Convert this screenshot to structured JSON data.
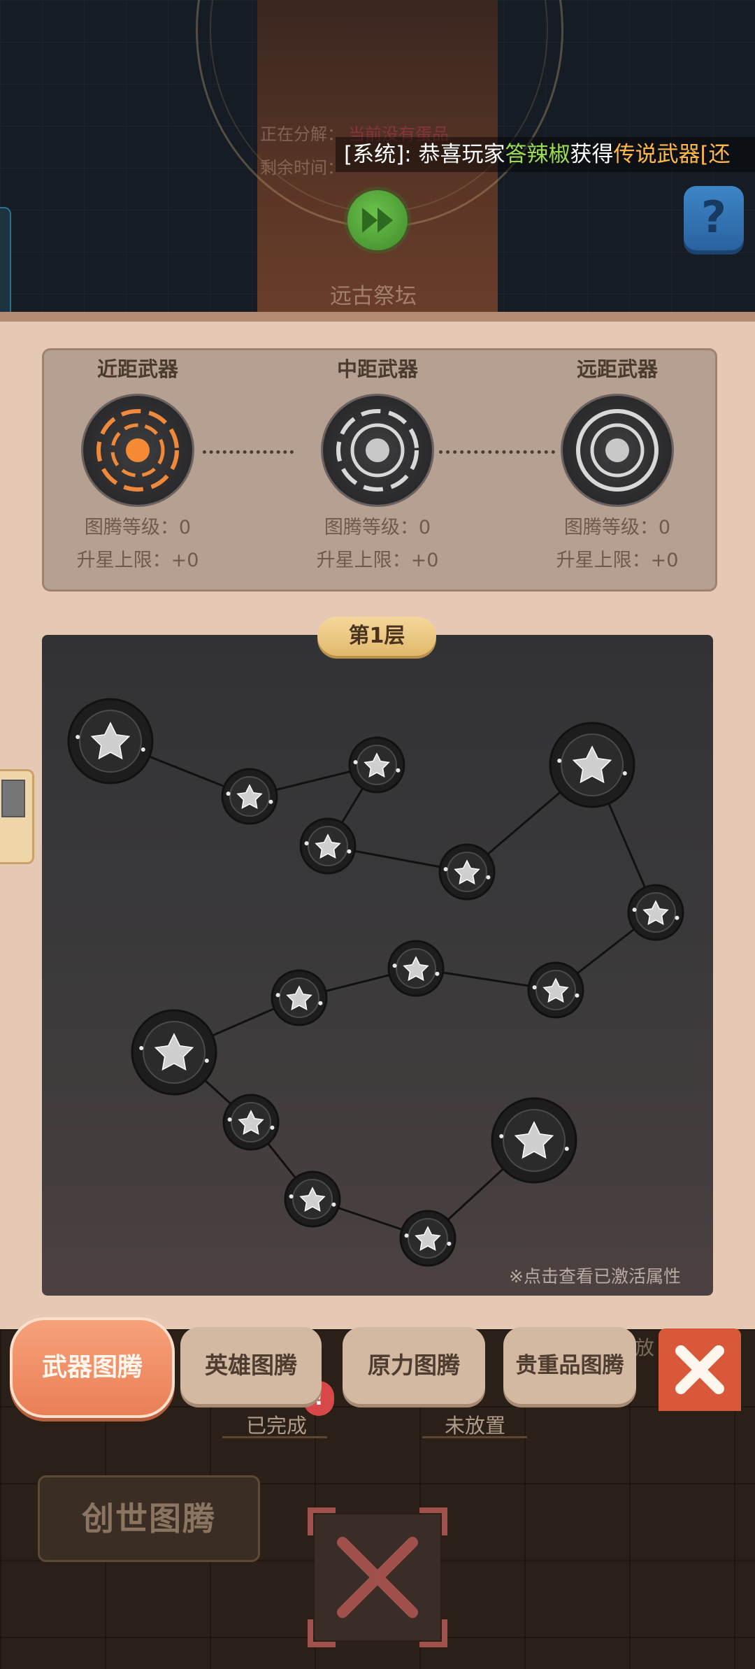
{
  "top_scene": {
    "decompose_label": "正在分解：",
    "decompose_value": "当前没有蛋品",
    "remaining_label": "剩余时间：",
    "system_prefix": "[系统]: 恭喜玩家",
    "system_player": "答辣椒",
    "system_middle": "获得",
    "system_item": "传说武器",
    "system_tail": "[还",
    "altar_label": "远古祭坛",
    "help_icon": "?"
  },
  "weapon_types": [
    {
      "title": "近距武器",
      "level_label": "图腾等级：0",
      "star_label": "升星上限：+0",
      "active": true
    },
    {
      "title": "中距武器",
      "level_label": "图腾等级：0",
      "star_label": "升星上限：+0",
      "active": false
    },
    {
      "title": "远距武器",
      "level_label": "图腾等级：0",
      "star_label": "升星上限：+0",
      "active": false
    }
  ],
  "board": {
    "layer_label": "第1层",
    "hint": "※点击查看已激活属性",
    "node_icon": "star-icon"
  },
  "tabs": {
    "weapon": "武器图腾",
    "hero": "英雄图腾",
    "force": "原力图腾",
    "treasure": "贵重品图腾",
    "peek_label": "放"
  },
  "bottom": {
    "status_done": "已完成",
    "status_empty": "未放置",
    "badge": "!",
    "creation": "创世图腾"
  },
  "colors": {
    "accent_orange": "#ea7f57",
    "panel_bg": "#e6c9b4",
    "board_bg": "#323236",
    "close_red": "#d9583a",
    "system_green": "#9ddc52",
    "system_orange": "#ffb64a"
  }
}
